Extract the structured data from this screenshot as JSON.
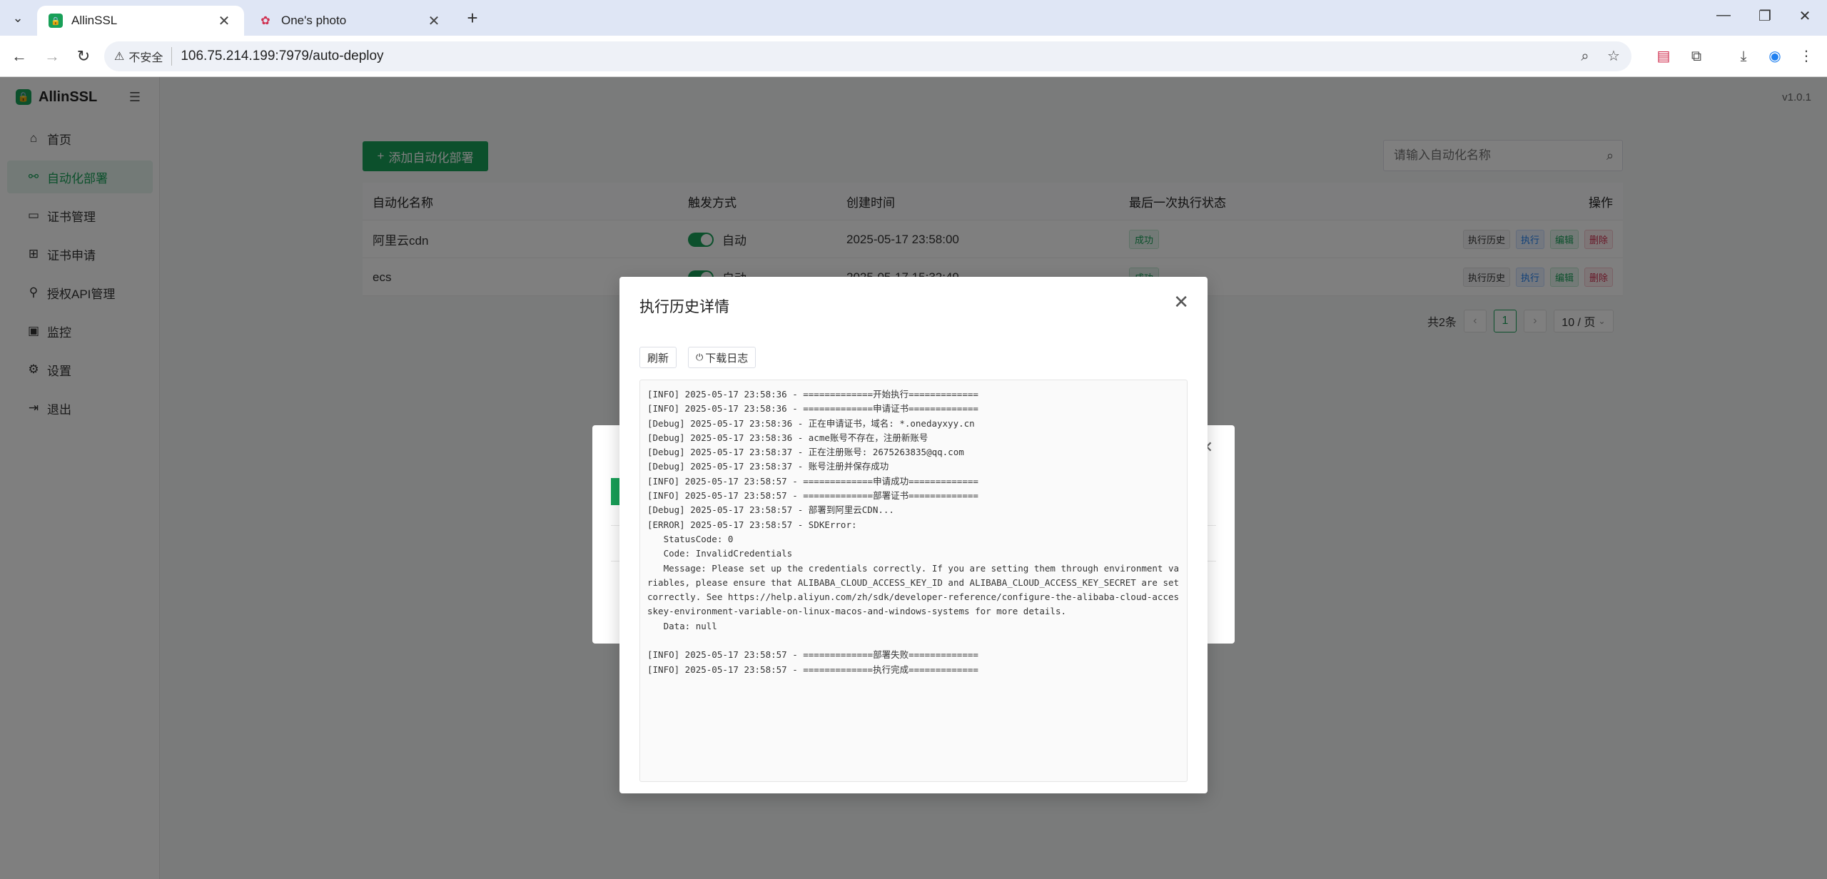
{
  "browser": {
    "tabs": [
      {
        "label": "AllinSSL",
        "active": true,
        "icon": "allinssl-favicon"
      },
      {
        "label": "One's photo",
        "active": false,
        "icon": "photo-favicon"
      }
    ],
    "security_label": "不安全",
    "url": "106.75.214.199:7979/auto-deploy"
  },
  "sidebar": {
    "brand": "AllinSSL",
    "items": [
      {
        "label": "首页",
        "icon": "home-icon",
        "active": false
      },
      {
        "label": "自动化部署",
        "icon": "deploy-icon",
        "active": true
      },
      {
        "label": "证书管理",
        "icon": "certificate-icon",
        "active": false
      },
      {
        "label": "证书申请",
        "icon": "apply-icon",
        "active": false
      },
      {
        "label": "授权API管理",
        "icon": "api-icon",
        "active": false
      },
      {
        "label": "监控",
        "icon": "monitor-icon",
        "active": false
      },
      {
        "label": "设置",
        "icon": "settings-icon",
        "active": false
      },
      {
        "label": "退出",
        "icon": "logout-icon",
        "active": false
      }
    ]
  },
  "header": {
    "version": "v1.0.1"
  },
  "toolbar": {
    "add_label": "添加自动化部署",
    "search_placeholder": "请输入自动化名称"
  },
  "table": {
    "columns": [
      "自动化名称",
      "触发方式",
      "创建时间",
      "最后一次执行状态",
      "操作"
    ],
    "rows": [
      {
        "name": "阿里云cdn",
        "trigger": "自动",
        "created": "2025-05-17 23:58:00",
        "status": "成功"
      },
      {
        "name": "ecs",
        "trigger": "自动",
        "created": "2025-05-17 15:32:49",
        "status": "成功"
      }
    ],
    "actions": {
      "history": "执行历史",
      "run": "执行",
      "edit": "编辑",
      "delete": "删除"
    }
  },
  "pagination": {
    "total": "共2条",
    "current": "1",
    "page_size": "10 / 页"
  },
  "modal": {
    "title": "执行历史详情",
    "refresh_label": "刷新",
    "download_label": "下载日志",
    "log": "[INFO] 2025-05-17 23:58:36 - =============开始执行=============\n[INFO] 2025-05-17 23:58:36 - =============申请证书=============\n[Debug] 2025-05-17 23:58:36 - 正在申请证书，域名: *.onedayxyy.cn\n[Debug] 2025-05-17 23:58:36 - acme账号不存在，注册新账号\n[Debug] 2025-05-17 23:58:37 - 正在注册账号: 2675263835@qq.com\n[Debug] 2025-05-17 23:58:37 - 账号注册并保存成功\n[INFO] 2025-05-17 23:58:57 - =============申请成功=============\n[INFO] 2025-05-17 23:58:57 - =============部署证书=============\n[Debug] 2025-05-17 23:58:57 - 部署到阿里云CDN...\n[ERROR] 2025-05-17 23:58:57 - SDKError:\n   StatusCode: 0\n   Code: InvalidCredentials\n   Message: Please set up the credentials correctly. If you are setting them through environment variables, please ensure that ALIBABA_CLOUD_ACCESS_KEY_ID and ALIBABA_CLOUD_ACCESS_KEY_SECRET are set correctly. See https://help.aliyun.com/zh/sdk/developer-reference/configure-the-alibaba-cloud-accesskey-environment-variable-on-linux-macos-and-windows-systems for more details.\n   Data: null\n\n[INFO] 2025-05-17 23:58:57 - =============部署失败=============\n[INFO] 2025-05-17 23:58:57 - =============执行完成============="
  },
  "colors": {
    "brand": "#18a058",
    "run": "#2080f0",
    "danger": "#d03050"
  }
}
